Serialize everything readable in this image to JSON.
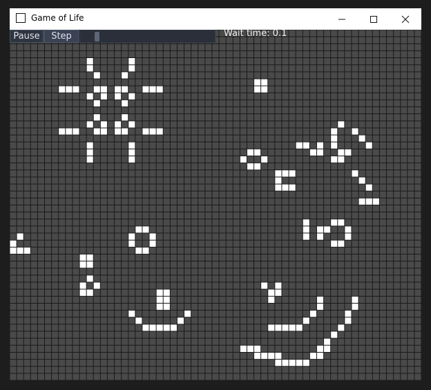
{
  "window": {
    "title": "Game of Life",
    "controls": {
      "minimize": "minimize-icon",
      "maximize": "maximize-icon",
      "close": "close-icon"
    }
  },
  "toolbar": {
    "pause_label": "Pause",
    "step_label": "Step",
    "wait_label": "Wait time: 0.1",
    "speed_slider_level": 0.11
  },
  "grid": {
    "cols": 59,
    "rows": 50,
    "colors": {
      "dead": "#4a4a4a",
      "alive": "#ffffff",
      "line": "#1a1a1a"
    },
    "alive": [
      [
        11,
        4
      ],
      [
        17,
        4
      ],
      [
        11,
        5
      ],
      [
        17,
        5
      ],
      [
        12,
        6
      ],
      [
        16,
        6
      ],
      [
        7,
        8
      ],
      [
        8,
        8
      ],
      [
        9,
        8
      ],
      [
        12,
        8
      ],
      [
        13,
        8
      ],
      [
        15,
        8
      ],
      [
        16,
        8
      ],
      [
        19,
        8
      ],
      [
        20,
        8
      ],
      [
        21,
        8
      ],
      [
        11,
        9
      ],
      [
        13,
        9
      ],
      [
        15,
        9
      ],
      [
        17,
        9
      ],
      [
        12,
        10
      ],
      [
        16,
        10
      ],
      [
        12,
        12
      ],
      [
        16,
        12
      ],
      [
        11,
        13
      ],
      [
        13,
        13
      ],
      [
        15,
        13
      ],
      [
        17,
        13
      ],
      [
        7,
        14
      ],
      [
        8,
        14
      ],
      [
        9,
        14
      ],
      [
        12,
        14
      ],
      [
        13,
        14
      ],
      [
        15,
        14
      ],
      [
        16,
        14
      ],
      [
        19,
        14
      ],
      [
        20,
        14
      ],
      [
        21,
        14
      ],
      [
        11,
        16
      ],
      [
        17,
        16
      ],
      [
        11,
        17
      ],
      [
        17,
        17
      ],
      [
        11,
        18
      ],
      [
        17,
        18
      ],
      [
        35,
        7
      ],
      [
        36,
        7
      ],
      [
        35,
        8
      ],
      [
        36,
        8
      ],
      [
        47,
        13
      ],
      [
        46,
        14
      ],
      [
        49,
        14
      ],
      [
        46,
        15
      ],
      [
        50,
        15
      ],
      [
        41,
        16
      ],
      [
        42,
        16
      ],
      [
        44,
        16
      ],
      [
        46,
        16
      ],
      [
        51,
        16
      ],
      [
        43,
        17
      ],
      [
        44,
        17
      ],
      [
        47,
        17
      ],
      [
        48,
        17
      ],
      [
        34,
        17
      ],
      [
        35,
        17
      ],
      [
        33,
        18
      ],
      [
        36,
        18
      ],
      [
        46,
        18
      ],
      [
        47,
        18
      ],
      [
        34,
        19
      ],
      [
        35,
        19
      ],
      [
        38,
        20
      ],
      [
        39,
        20
      ],
      [
        40,
        20
      ],
      [
        49,
        20
      ],
      [
        38,
        21
      ],
      [
        50,
        21
      ],
      [
        38,
        22
      ],
      [
        39,
        22
      ],
      [
        40,
        22
      ],
      [
        51,
        22
      ],
      [
        50,
        24
      ],
      [
        51,
        24
      ],
      [
        52,
        24
      ],
      [
        42,
        27
      ],
      [
        46,
        27
      ],
      [
        47,
        27
      ],
      [
        42,
        28
      ],
      [
        44,
        28
      ],
      [
        45,
        28
      ],
      [
        48,
        28
      ],
      [
        42,
        29
      ],
      [
        44,
        29
      ],
      [
        48,
        29
      ],
      [
        46,
        30
      ],
      [
        47,
        30
      ],
      [
        18,
        28
      ],
      [
        19,
        28
      ],
      [
        17,
        29
      ],
      [
        20,
        29
      ],
      [
        17,
        30
      ],
      [
        20,
        30
      ],
      [
        18,
        31
      ],
      [
        19,
        31
      ],
      [
        1,
        29
      ],
      [
        0,
        30
      ],
      [
        0,
        31
      ],
      [
        1,
        31
      ],
      [
        2,
        31
      ],
      [
        10,
        32
      ],
      [
        11,
        32
      ],
      [
        10,
        33
      ],
      [
        11,
        33
      ],
      [
        11,
        35
      ],
      [
        10,
        36
      ],
      [
        12,
        36
      ],
      [
        10,
        37
      ],
      [
        11,
        37
      ],
      [
        36,
        36
      ],
      [
        38,
        36
      ],
      [
        37,
        37
      ],
      [
        38,
        37
      ],
      [
        21,
        37
      ],
      [
        22,
        37
      ],
      [
        21,
        38
      ],
      [
        22,
        38
      ],
      [
        21,
        39
      ],
      [
        22,
        39
      ],
      [
        37,
        38
      ],
      [
        44,
        38
      ],
      [
        49,
        38
      ],
      [
        44,
        39
      ],
      [
        49,
        39
      ],
      [
        17,
        40
      ],
      [
        25,
        40
      ],
      [
        43,
        40
      ],
      [
        48,
        40
      ],
      [
        18,
        41
      ],
      [
        24,
        41
      ],
      [
        42,
        41
      ],
      [
        48,
        41
      ],
      [
        19,
        42
      ],
      [
        20,
        42
      ],
      [
        21,
        42
      ],
      [
        22,
        42
      ],
      [
        23,
        42
      ],
      [
        37,
        42
      ],
      [
        38,
        42
      ],
      [
        39,
        42
      ],
      [
        40,
        42
      ],
      [
        41,
        42
      ],
      [
        47,
        42
      ],
      [
        46,
        43
      ],
      [
        45,
        44
      ],
      [
        33,
        45
      ],
      [
        34,
        45
      ],
      [
        35,
        45
      ],
      [
        44,
        45
      ],
      [
        45,
        45
      ],
      [
        35,
        46
      ],
      [
        36,
        46
      ],
      [
        37,
        46
      ],
      [
        38,
        46
      ],
      [
        43,
        46
      ],
      [
        44,
        46
      ],
      [
        38,
        47
      ],
      [
        39,
        47
      ],
      [
        40,
        47
      ],
      [
        41,
        47
      ],
      [
        42,
        47
      ]
    ]
  }
}
